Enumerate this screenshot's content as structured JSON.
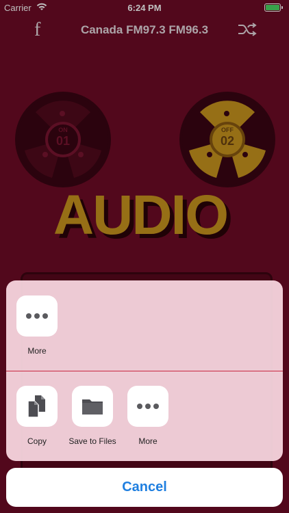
{
  "status_bar": {
    "carrier": "Carrier",
    "time": "6:24 PM"
  },
  "nav": {
    "facebook_glyph": "f",
    "title": "Canada FM97.3 FM96.3",
    "shuffle_icon": "shuffle-icon"
  },
  "reels": [
    {
      "top_label": "ON",
      "number": "01",
      "state": "dark"
    },
    {
      "top_label": "OFF",
      "number": "02",
      "state": "gold"
    }
  ],
  "logo_text": "AUDIO",
  "share_sheet": {
    "row1": [
      {
        "label": "More",
        "icon": "more-icon"
      }
    ],
    "row2": [
      {
        "label": "Copy",
        "icon": "copy-icon"
      },
      {
        "label": "Save to Files",
        "icon": "folder-icon"
      },
      {
        "label": "More",
        "icon": "more-icon"
      }
    ],
    "cancel_label": "Cancel"
  },
  "colors": {
    "background": "#6e0b26",
    "gold": "#c9951e",
    "accent_blue": "#1f7fe0",
    "battery_green": "#4cd964"
  }
}
